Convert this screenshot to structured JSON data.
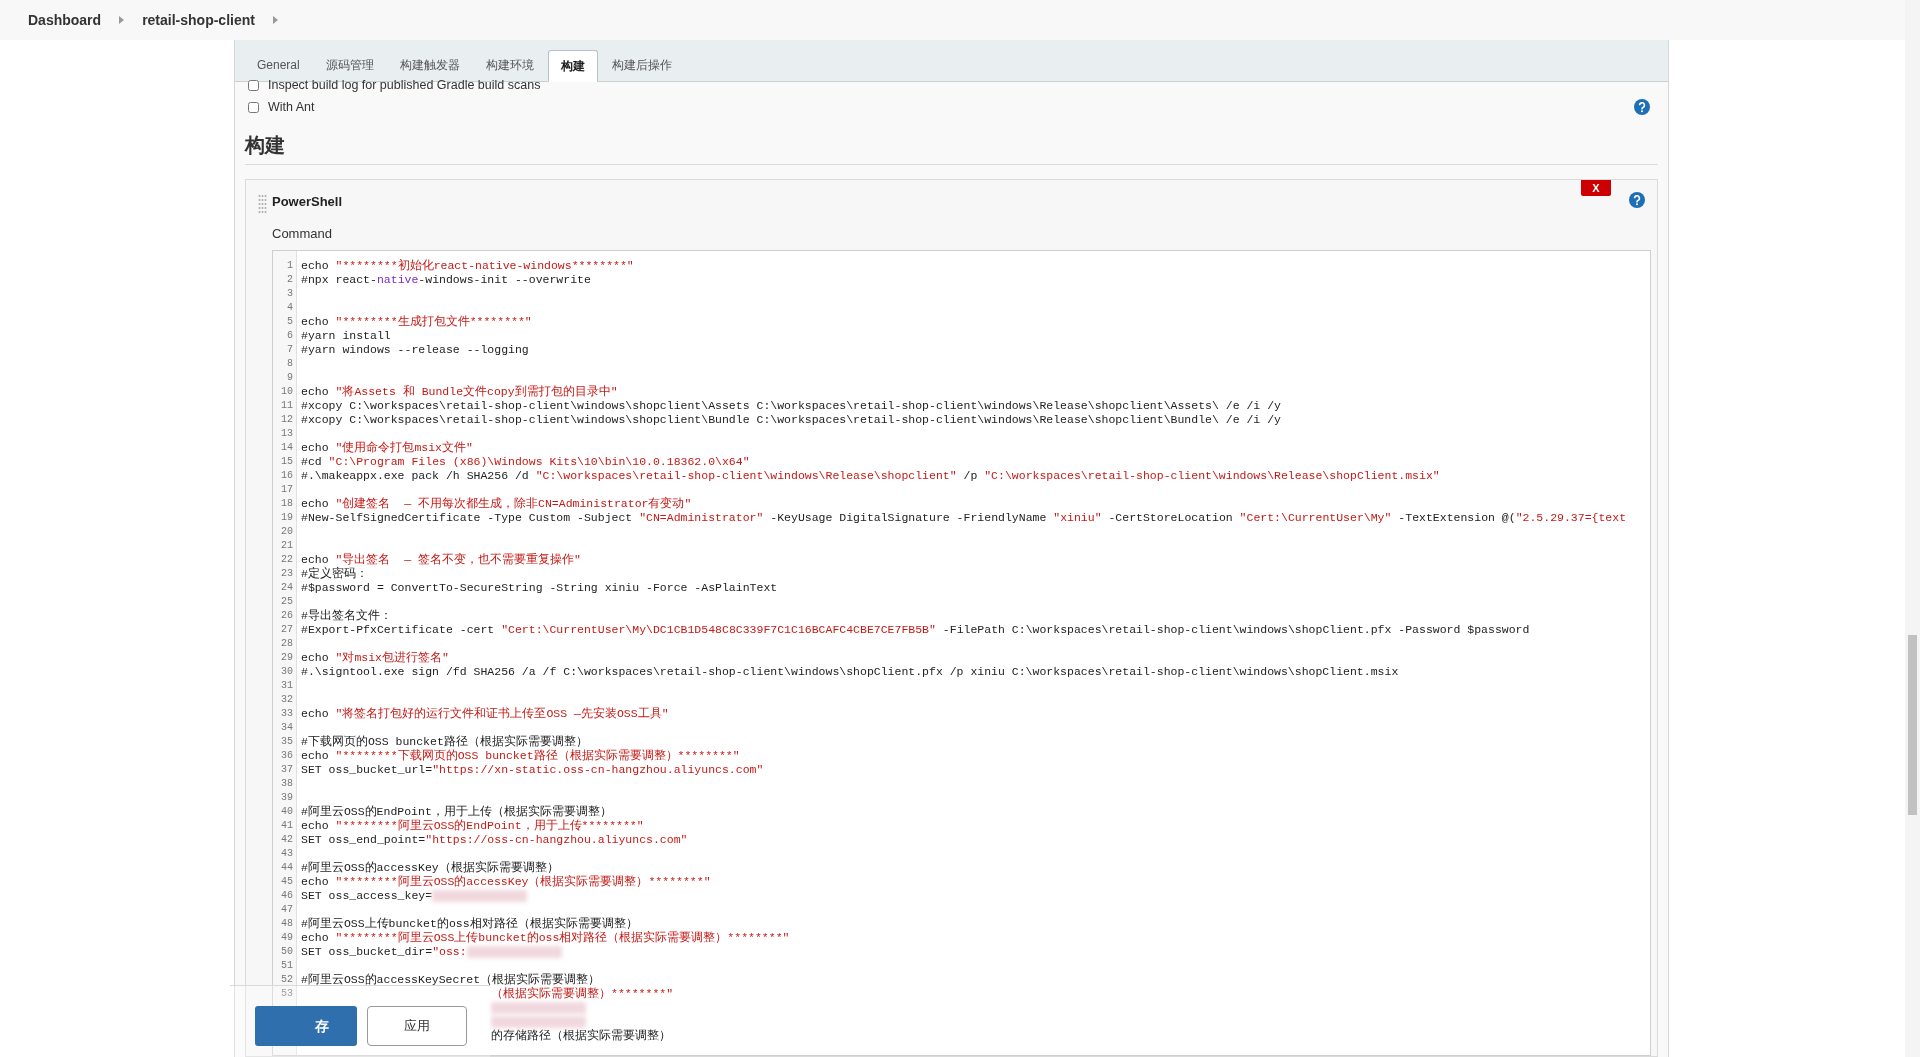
{
  "breadcrumb": [
    "Dashboard",
    "retail-shop-client"
  ],
  "tabs": [
    {
      "label": "General",
      "selected": false
    },
    {
      "label": "源码管理",
      "selected": false
    },
    {
      "label": "构建触发器",
      "selected": false
    },
    {
      "label": "构建环境",
      "selected": false
    },
    {
      "label": "构建",
      "selected": true
    },
    {
      "label": "构建后操作",
      "selected": false
    }
  ],
  "options": [
    {
      "label": "Inspect build log for published Gradle build scans",
      "checked": false
    },
    {
      "label": "With Ant",
      "checked": false
    }
  ],
  "section_title": "构建",
  "step": {
    "title": "PowerShell",
    "delete_label": "X",
    "field_label": "Command",
    "lines": [
      {
        "n": "1",
        "s": [
          {
            "kind": "plain",
            "text": "echo "
          },
          {
            "kind": "str",
            "text": "\"********初始化react-native-windows********\""
          }
        ]
      },
      {
        "n": "2",
        "s": [
          {
            "kind": "plain",
            "text": "#npx react-"
          },
          {
            "kind": "kw",
            "text": "native"
          },
          {
            "kind": "plain",
            "text": "-windows-init --overwrite"
          }
        ]
      },
      {
        "n": "3"
      },
      {
        "n": "4"
      },
      {
        "n": "5",
        "s": [
          {
            "kind": "plain",
            "text": "echo "
          },
          {
            "kind": "str",
            "text": "\"********生成打包文件********\""
          }
        ]
      },
      {
        "n": "6",
        "s": [
          {
            "kind": "plain",
            "text": "#yarn install"
          }
        ]
      },
      {
        "n": "7",
        "s": [
          {
            "kind": "plain",
            "text": "#yarn windows --release --logging"
          }
        ]
      },
      {
        "n": "8"
      },
      {
        "n": "9"
      },
      {
        "n": "10",
        "s": [
          {
            "kind": "plain",
            "text": "echo "
          },
          {
            "kind": "str",
            "text": "\"将Assets 和 Bundle文件copy到需打包的目录中\""
          }
        ]
      },
      {
        "n": "11",
        "s": [
          {
            "kind": "plain",
            "text": "#xcopy C:\\workspaces\\retail-shop-client\\windows\\shopclient\\Assets C:\\workspaces\\retail-shop-client\\windows\\Release\\shopclient\\Assets\\ /e /i /y"
          }
        ]
      },
      {
        "n": "12",
        "s": [
          {
            "kind": "plain",
            "text": "#xcopy C:\\workspaces\\retail-shop-client\\windows\\shopclient\\Bundle C:\\workspaces\\retail-shop-client\\windows\\Release\\shopclient\\Bundle\\ /e /i /y"
          }
        ]
      },
      {
        "n": "13"
      },
      {
        "n": "14",
        "s": [
          {
            "kind": "plain",
            "text": "echo "
          },
          {
            "kind": "str",
            "text": "\"使用命令打包msix文件\""
          }
        ]
      },
      {
        "n": "15",
        "s": [
          {
            "kind": "plain",
            "text": "#cd "
          },
          {
            "kind": "str",
            "text": "\"C:\\Program Files (x86)\\Windows Kits\\10\\bin\\10.0.18362.0\\x64\""
          }
        ]
      },
      {
        "n": "16",
        "s": [
          {
            "kind": "plain",
            "text": "#.\\makeappx.exe pack /h SHA256 /d "
          },
          {
            "kind": "str",
            "text": "\"C:\\workspaces\\retail-shop-client\\windows\\Release\\shopclient\""
          },
          {
            "kind": "plain",
            "text": " /p "
          },
          {
            "kind": "str",
            "text": "\"C:\\workspaces\\retail-shop-client\\windows\\Release\\shopClient.msix\""
          }
        ]
      },
      {
        "n": "17"
      },
      {
        "n": "18",
        "s": [
          {
            "kind": "plain",
            "text": "echo "
          },
          {
            "kind": "str",
            "text": "\"创建签名  — 不用每次都生成，除非CN=Administrator有变动\""
          }
        ]
      },
      {
        "n": "19",
        "s": [
          {
            "kind": "plain",
            "text": "#New-SelfSignedCertificate -Type Custom -Subject "
          },
          {
            "kind": "str",
            "text": "\"CN=Administrator\""
          },
          {
            "kind": "plain",
            "text": " -KeyUsage DigitalSignature -FriendlyName "
          },
          {
            "kind": "str",
            "text": "\"xiniu\""
          },
          {
            "kind": "plain",
            "text": " -CertStoreLocation "
          },
          {
            "kind": "str",
            "text": "\"Cert:\\CurrentUser\\My\""
          },
          {
            "kind": "plain",
            "text": " -TextExtension @("
          },
          {
            "kind": "str",
            "text": "\"2.5.29.37={text"
          }
        ]
      },
      {
        "n": "20"
      },
      {
        "n": "21"
      },
      {
        "n": "22",
        "s": [
          {
            "kind": "plain",
            "text": "echo "
          },
          {
            "kind": "str",
            "text": "\"导出签名  — 签名不变，也不需要重复操作\""
          }
        ]
      },
      {
        "n": "23",
        "s": [
          {
            "kind": "plain",
            "text": "#定义密码："
          }
        ]
      },
      {
        "n": "24",
        "s": [
          {
            "kind": "plain",
            "text": "#$password = ConvertTo-SecureString -String xiniu -Force -AsPlainText"
          }
        ]
      },
      {
        "n": "25"
      },
      {
        "n": "26",
        "s": [
          {
            "kind": "plain",
            "text": "#导出签名文件："
          }
        ]
      },
      {
        "n": "27",
        "s": [
          {
            "kind": "plain",
            "text": "#Export-PfxCertificate -cert "
          },
          {
            "kind": "str",
            "text": "\"Cert:\\CurrentUser\\My\\DC1CB1D548C8C339F7C1C16BCAFC4CBE7CE7FB5B\""
          },
          {
            "kind": "plain",
            "text": " -FilePath C:\\workspaces\\retail-shop-client\\windows\\shopClient.pfx -Password $password"
          }
        ]
      },
      {
        "n": "28"
      },
      {
        "n": "29",
        "s": [
          {
            "kind": "plain",
            "text": "echo "
          },
          {
            "kind": "str",
            "text": "\"对msix包进行签名\""
          }
        ]
      },
      {
        "n": "30",
        "s": [
          {
            "kind": "plain",
            "text": "#.\\signtool.exe sign /fd SHA256 /a /f C:\\workspaces\\retail-shop-client\\windows\\shopClient.pfx /p xiniu C:\\workspaces\\retail-shop-client\\windows\\shopClient.msix"
          }
        ]
      },
      {
        "n": "31"
      },
      {
        "n": "32"
      },
      {
        "n": "33",
        "s": [
          {
            "kind": "plain",
            "text": "echo "
          },
          {
            "kind": "str",
            "text": "\"将签名打包好的运行文件和证书上传至OSS —先安装OSS工具\""
          }
        ]
      },
      {
        "n": "34"
      },
      {
        "n": "35",
        "s": [
          {
            "kind": "plain",
            "text": "#下载网页的OSS buncket路径（根据实际需要调整）"
          }
        ]
      },
      {
        "n": "36",
        "s": [
          {
            "kind": "plain",
            "text": "echo "
          },
          {
            "kind": "str",
            "text": "\"********下载网页的OSS buncket路径（根据实际需要调整）********\""
          }
        ]
      },
      {
        "n": "37",
        "s": [
          {
            "kind": "plain",
            "text": "SET oss_bucket_url="
          },
          {
            "kind": "str",
            "text": "\"https://xn-static.oss-cn-hangzhou.aliyuncs.com\""
          }
        ]
      },
      {
        "n": "38"
      },
      {
        "n": "39"
      },
      {
        "n": "40",
        "s": [
          {
            "kind": "plain",
            "text": "#阿里云OSS的EndPoint，用于上传（根据实际需要调整）"
          }
        ]
      },
      {
        "n": "41",
        "s": [
          {
            "kind": "plain",
            "text": "echo "
          },
          {
            "kind": "str",
            "text": "\"********阿里云OSS的EndPoint，用于上传********\""
          }
        ]
      },
      {
        "n": "42",
        "s": [
          {
            "kind": "plain",
            "text": "SET oss_end_point="
          },
          {
            "kind": "str",
            "text": "\"https://oss-cn-hangzhou.aliyuncs.com\""
          }
        ]
      },
      {
        "n": "43"
      },
      {
        "n": "44",
        "s": [
          {
            "kind": "plain",
            "text": "#阿里云OSS的accessKey（根据实际需要调整）"
          }
        ]
      },
      {
        "n": "45",
        "s": [
          {
            "kind": "plain",
            "text": "echo "
          },
          {
            "kind": "str",
            "text": "\"********阿里云OSS的accessKey（根据实际需要调整）********\""
          }
        ]
      },
      {
        "n": "46",
        "s": [
          {
            "kind": "plain",
            "text": "SET oss_access_key="
          },
          {
            "kind": "blur"
          }
        ]
      },
      {
        "n": "47"
      },
      {
        "n": "48",
        "s": [
          {
            "kind": "plain",
            "text": "#阿里云OSS上传buncket的oss相对路径（根据实际需要调整）"
          }
        ]
      },
      {
        "n": "49",
        "s": [
          {
            "kind": "plain",
            "text": "echo "
          },
          {
            "kind": "str",
            "text": "\"********阿里云OSS上传buncket的oss相对路径（根据实际需要调整）********\""
          }
        ]
      },
      {
        "n": "50",
        "s": [
          {
            "kind": "plain",
            "text": "SET oss_bucket_dir="
          },
          {
            "kind": "str",
            "text": "\"oss:"
          },
          {
            "kind": "blur"
          }
        ]
      },
      {
        "n": "51"
      },
      {
        "n": "52",
        "s": [
          {
            "kind": "plain",
            "text": "#阿里云OSS的accessKeySecret（根据实际需要调整）"
          }
        ]
      },
      {
        "n": "53",
        "s": [
          {
            "kind": "gap"
          },
          {
            "kind": "str",
            "text": "（根据实际需要调整）********\""
          }
        ]
      },
      {
        "s": [
          {
            "kind": "gap"
          },
          {
            "kind": "blur"
          }
        ]
      },
      {
        "s": [
          {
            "kind": "gap"
          },
          {
            "kind": "blur"
          }
        ]
      },
      {
        "s": [
          {
            "kind": "gap"
          },
          {
            "kind": "plain",
            "text": "的存储路径（根据实际需要调整）"
          }
        ]
      }
    ]
  },
  "buttons": [
    {
      "label": "存",
      "kind": "primary"
    },
    {
      "label": "应用",
      "kind": "secondary"
    }
  ]
}
